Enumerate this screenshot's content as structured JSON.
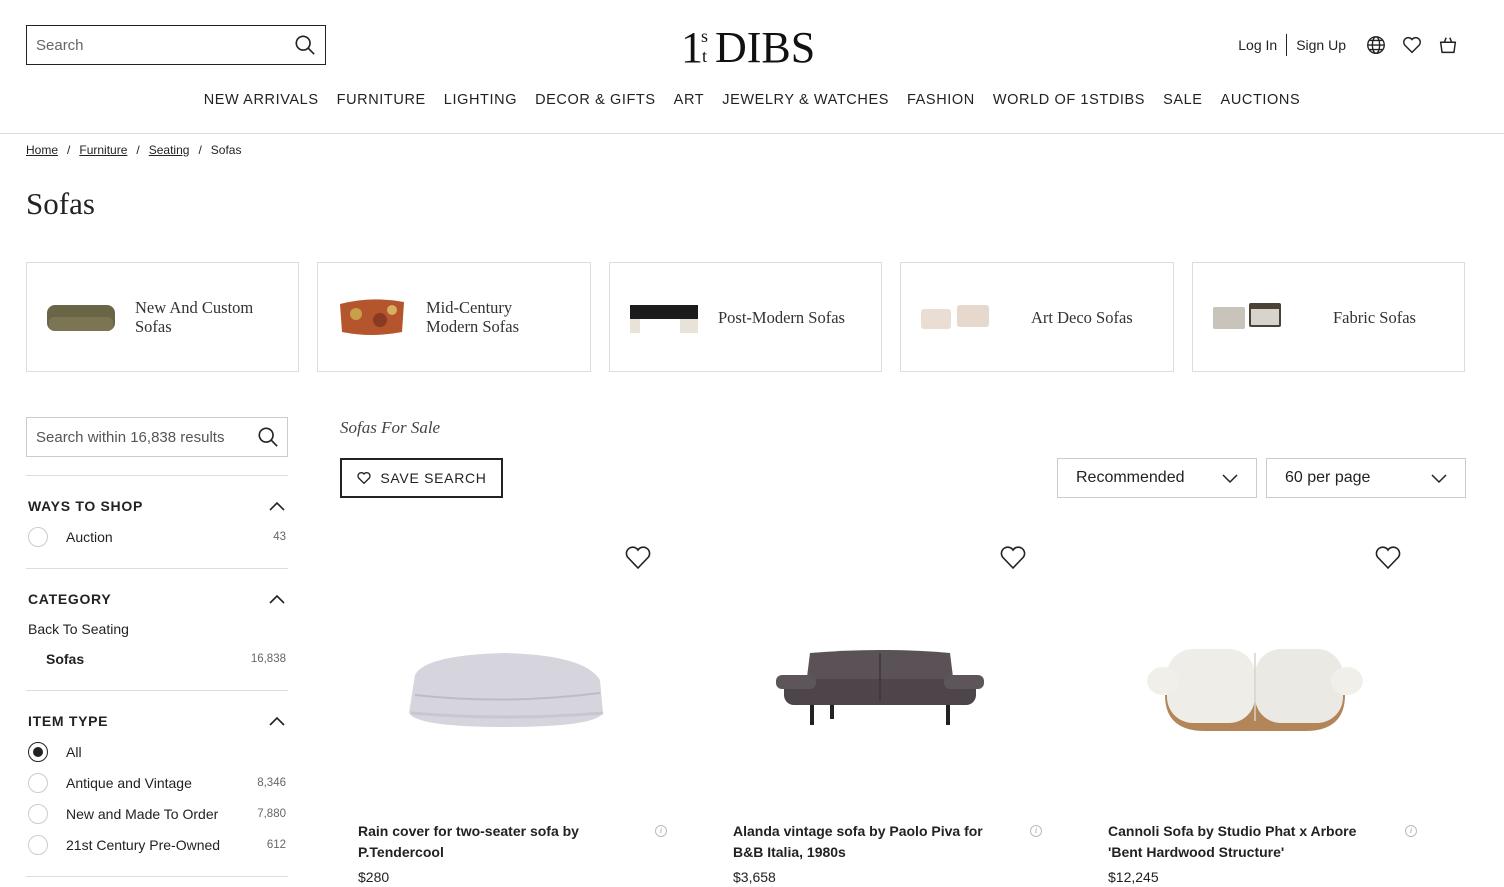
{
  "header": {
    "search_placeholder": "Search",
    "logo_text": "1stDIBS",
    "login": "Log In",
    "signup": "Sign Up"
  },
  "nav": {
    "items": [
      "NEW ARRIVALS",
      "FURNITURE",
      "LIGHTING",
      "DECOR & GIFTS",
      "ART",
      "JEWELRY & WATCHES",
      "FASHION",
      "WORLD OF 1STDIBS",
      "SALE",
      "AUCTIONS"
    ]
  },
  "breadcrumb": {
    "items": [
      "Home",
      "Furniture",
      "Seating"
    ],
    "current": "Sofas"
  },
  "page": {
    "title": "Sofas"
  },
  "categories": [
    {
      "label": "New And Custom Sofas"
    },
    {
      "label": "Mid-Century Modern Sofas"
    },
    {
      "label": "Post-Modern Sofas"
    },
    {
      "label": "Art Deco Sofas"
    },
    {
      "label": "Fabric Sofas"
    }
  ],
  "sidebar": {
    "search_placeholder": "Search within 16,838 results",
    "ways_to_shop": {
      "title": "WAYS TO SHOP",
      "options": [
        {
          "label": "Auction",
          "count": "43"
        }
      ]
    },
    "category": {
      "title": "CATEGORY",
      "back": "Back To Seating",
      "current": {
        "label": "Sofas",
        "count": "16,838"
      }
    },
    "item_type": {
      "title": "ITEM TYPE",
      "options": [
        {
          "label": "All",
          "count": "",
          "checked": true
        },
        {
          "label": "Antique and Vintage",
          "count": "8,346",
          "checked": false
        },
        {
          "label": "New and Made To Order",
          "count": "7,880",
          "checked": false
        },
        {
          "label": "21st Century Pre-Owned",
          "count": "612",
          "checked": false
        }
      ]
    }
  },
  "results": {
    "title": "Sofas For Sale",
    "save_search": "SAVE SEARCH",
    "sort": "Recommended",
    "per_page": "60 per page"
  },
  "products": [
    {
      "title": "Rain cover for two-seater sofa by P.Tendercool",
      "price": "$280"
    },
    {
      "title": "Alanda vintage sofa by Paolo Piva for B&B Italia, 1980s",
      "price": "$3,658"
    },
    {
      "title": "Cannoli Sofa by Studio Phat x Arbore 'Bent Hardwood Structure'",
      "price": "$12,245"
    }
  ],
  "colors": {
    "text": "#222222",
    "border": "#dddddd",
    "muted": "#666666"
  }
}
